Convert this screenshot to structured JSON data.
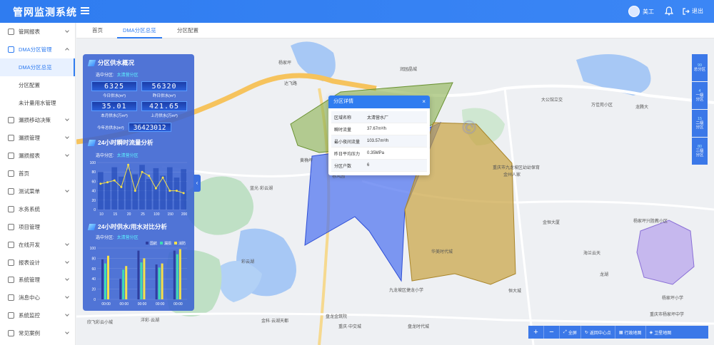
{
  "app": {
    "title": "管网监测系统",
    "user": "美工",
    "logout": "退出"
  },
  "sidebar": {
    "items": [
      {
        "label": "管网报表",
        "level": 0,
        "expand": "closed"
      },
      {
        "label": "DMA分区管理",
        "level": 0,
        "expand": "open",
        "active": true
      },
      {
        "label": "DMA分区总览",
        "level": 1,
        "selected": true
      },
      {
        "label": "分区配置",
        "level": 1
      },
      {
        "label": "未计量用水管理",
        "level": 1
      },
      {
        "label": "漏损移动决策",
        "level": 0,
        "expand": "closed"
      },
      {
        "label": "漏损管理",
        "level": 0,
        "expand": "closed"
      },
      {
        "label": "漏损报表",
        "level": 0,
        "expand": "closed"
      },
      {
        "label": "首页",
        "level": 0
      },
      {
        "label": "测试菜单",
        "level": 0,
        "expand": "closed"
      },
      {
        "label": "水务系统",
        "level": 0
      },
      {
        "label": "项目管理",
        "level": 0
      },
      {
        "label": "在线开发",
        "level": 0,
        "expand": "closed"
      },
      {
        "label": "报表设计",
        "level": 0,
        "expand": "closed"
      },
      {
        "label": "系统管理",
        "level": 0,
        "expand": "closed"
      },
      {
        "label": "消息中心",
        "level": 0,
        "expand": "closed"
      },
      {
        "label": "系统监控",
        "level": 0,
        "expand": "closed"
      },
      {
        "label": "常见案例",
        "level": 0,
        "expand": "closed"
      }
    ]
  },
  "tabs": [
    {
      "label": "首页"
    },
    {
      "label": "DMA分区总览",
      "active": true
    },
    {
      "label": "分区配置"
    }
  ],
  "panel": {
    "sec1_title": "分区供水概况",
    "selected_label": "选中分区:",
    "selected_value": "太清营分区",
    "today": "6325",
    "today_label": "今日供水(m³)",
    "yesterday": "56320",
    "yesterday_label": "昨日供水(m³)",
    "month": "35.01",
    "month_label": "本月供水(万m³)",
    "lastmonth": "421.65",
    "lastmonth_label": "上月供水(万m³)",
    "year": "36423012",
    "year_label": "今年总供水(m³)",
    "sec2_title": "24小时瞬时流量分析",
    "sec3_title": "24小时供水/用水对比分析",
    "legend": [
      "国航",
      "漏损",
      "消防"
    ]
  },
  "chart_data": [
    {
      "type": "bar",
      "title": "24小时瞬时流量分析",
      "categories": [
        "00:00",
        "02:00",
        "04:00",
        "06:00",
        "08:00",
        "10:00",
        "12:00",
        "14:00",
        "16:00",
        "18:00",
        "20:00",
        "22:00",
        "24:00"
      ],
      "series": [
        {
          "values": [
            80,
            60,
            90,
            70,
            85,
            75,
            95,
            65,
            88,
            72,
            90,
            68,
            86
          ]
        },
        {
          "values": [
            55,
            58,
            62,
            48,
            95,
            40,
            80,
            72,
            45,
            68,
            40,
            40,
            35
          ]
        }
      ],
      "x_ticks": [
        "10",
        "15",
        "20",
        "25",
        "100",
        "150",
        "200"
      ],
      "ylim": [
        0,
        100
      ],
      "y_ticks": [
        0,
        20,
        40,
        60,
        80,
        100
      ]
    },
    {
      "type": "bar",
      "title": "24小时供水/用水对比分析",
      "categories": [
        "00:00",
        "00:00",
        "00:00",
        "00:00",
        "00:00"
      ],
      "series": [
        {
          "name": "国航",
          "values": [
            78,
            40,
            95,
            68,
            95
          ]
        },
        {
          "name": "漏损",
          "values": [
            70,
            58,
            72,
            62,
            88
          ]
        },
        {
          "name": "消防",
          "values": [
            85,
            65,
            80,
            70,
            98
          ]
        }
      ],
      "ylim": [
        0,
        100
      ],
      "y_ticks": [
        0,
        20,
        40,
        60,
        80,
        100
      ]
    }
  ],
  "popup": {
    "title": "分区详情",
    "rows": [
      {
        "k": "区域名称",
        "v": "太清营水厂"
      },
      {
        "k": "瞬时流量",
        "v": "37.67m³/h"
      },
      {
        "k": "最小夜间流量",
        "v": "103.57m³/h"
      },
      {
        "k": "昨日平均压力",
        "v": "0.35MPa"
      },
      {
        "k": "分区户数",
        "v": "6"
      }
    ]
  },
  "right_stack": [
    {
      "n": "99",
      "l1": "总分区"
    },
    {
      "n": "4",
      "l1": "一级",
      "l2": "分区"
    },
    {
      "n": "15",
      "l1": "二级",
      "l2": "分区"
    },
    {
      "n": "80",
      "l1": "三级",
      "l2": "分区"
    }
  ],
  "toolbar": {
    "zoom_in": "+",
    "zoom_out": "−",
    "fullscreen": "全屏",
    "center": "返回中心点",
    "admin": "行政地图",
    "satellite": "卫星地图"
  },
  "map_labels": [
    "杨家坪",
    "达飞路",
    "重庆市九龙坡区幼幼保育",
    "大公馆立交",
    "万佳苑小区",
    "龙腾大",
    "金州人家",
    "金恒大厦",
    "海兰云天",
    "杨家坪兴胜教小区",
    "彩云湖",
    "九龙坡区捷龙小学",
    "恒大城",
    "重庆市杨家坪中学",
    "金科·云湖天都",
    "盘龙金筑院",
    "重庆·中交城",
    "盘龙时代城",
    "洋彩·云湖",
    "春风园",
    "黄桷坪",
    "润园晶城",
    "华美时代城",
    "欣飞彩云小城",
    "龙湖",
    "杨家坪小学",
    "蓝光·彩云湖"
  ],
  "colors": {
    "primary": "#2f7cf0",
    "zone_blue": "#4a6ff0",
    "zone_gold": "#c9a340",
    "zone_green": "#8bb04e",
    "zone_purple": "#a58bea"
  }
}
